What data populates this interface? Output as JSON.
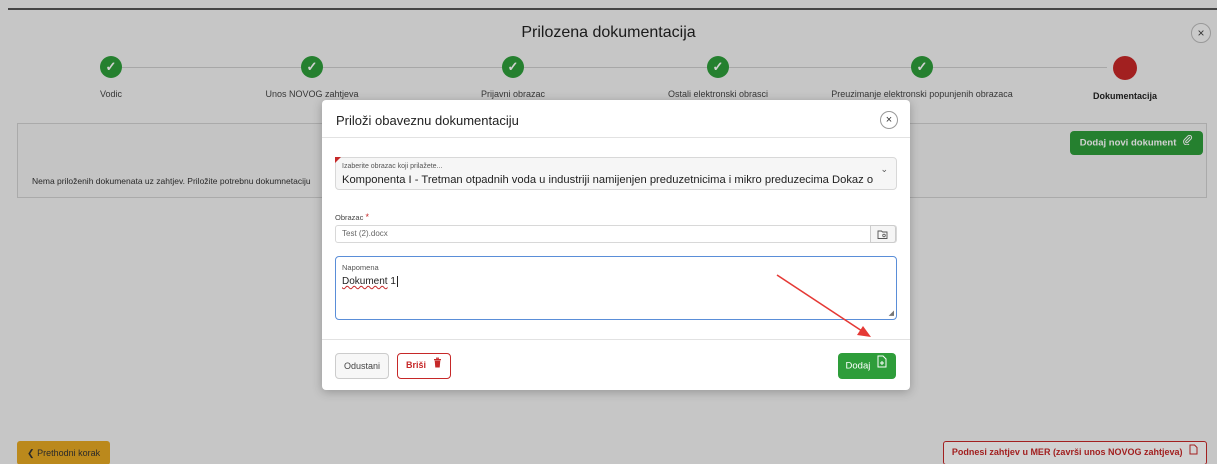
{
  "page": {
    "title": "Prilozena dokumentacija",
    "close_label": "×"
  },
  "stepper": {
    "steps": [
      {
        "label": "Vodic",
        "state": "done"
      },
      {
        "label": "Unos NOVOG zahtjeva",
        "state": "done"
      },
      {
        "label": "Prijavni obrazac",
        "state": "done"
      },
      {
        "label": "Ostali elektronski obrasci",
        "state": "done"
      },
      {
        "label": "Preuzimanje elektronski popunjenih obrazaca",
        "state": "done"
      },
      {
        "label": "Dokumentacija",
        "state": "current"
      }
    ],
    "check_glyph": "✓",
    "colors": {
      "done": "#2e9d3a",
      "current": "#c62828"
    }
  },
  "documents_panel": {
    "empty_text": "Nema priloženih dokumenata uz zahtjev. Priložite potrebnu dokumnetaciju",
    "add_button_label": "Dodaj novi dokument",
    "add_button_icon": "paperclip-icon"
  },
  "footer": {
    "prev_button_label": "Prethodni korak",
    "prev_icon": "chevron-left-icon",
    "submit_button_label": "Podnesi zahtjev u MER (završi unos NOVOG zahtjeva)",
    "submit_icon": "document-icon"
  },
  "modal": {
    "title": "Priloži obaveznu dokumentaciju",
    "close_label": "×",
    "select": {
      "label": "Izaberite obrazac koji prilažete...",
      "value": "Komponenta I - Tretman otpadnih voda u industriji namijenjen preduzetnicima i mikro preduzecima Dokaz o"
    },
    "file": {
      "label": "Obrazac",
      "required_mark": "*",
      "value": "Test (2).docx",
      "icon": "folder-search-icon"
    },
    "note": {
      "label": "Napomena",
      "value_word": "Dokument",
      "value_rest": " 1"
    },
    "buttons": {
      "cancel": "Odustani",
      "delete": "Briši",
      "delete_icon": "trash-icon",
      "add": "Dodaj",
      "add_icon": "file-add-icon"
    }
  },
  "annotation": {
    "color": "#e53935",
    "icon": "red-arrow-icon"
  }
}
